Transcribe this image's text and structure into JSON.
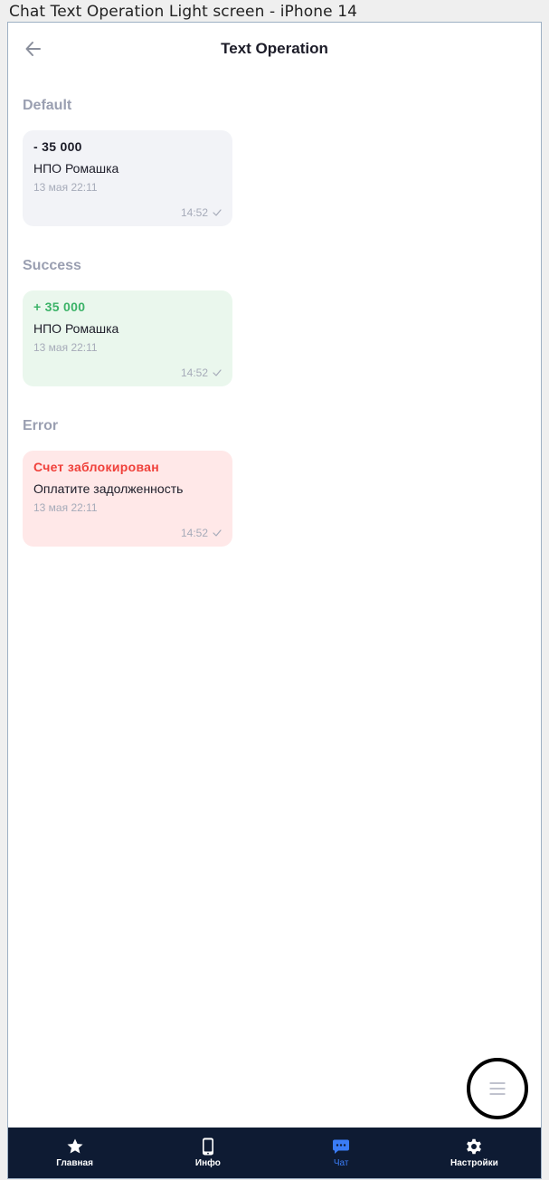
{
  "frame": {
    "title": "Chat Text Operation Light screen - iPhone 14"
  },
  "header": {
    "title": "Text Operation",
    "back_icon": "arrow-left-icon"
  },
  "sections": [
    {
      "label": "Default",
      "bubble": {
        "variant": "default",
        "amount": "- 35 000",
        "company": "НПО Ромашка",
        "date": "13 мая 22:11",
        "time": "14:52"
      }
    },
    {
      "label": "Success",
      "bubble": {
        "variant": "success",
        "amount": "+ 35 000",
        "company": "НПО Ромашка",
        "date": "13 мая 22:11",
        "time": "14:52"
      }
    },
    {
      "label": "Error",
      "bubble": {
        "variant": "error",
        "amount": "Счет заблокирован",
        "company": "Оплатите задолженность",
        "date": "13 мая 22:11",
        "time": "14:52"
      }
    }
  ],
  "fab": {
    "icon": "menu-icon"
  },
  "tabbar": {
    "items": [
      {
        "label": "Главная",
        "icon": "star-icon",
        "active": false
      },
      {
        "label": "Инфо",
        "icon": "phone-icon",
        "active": false
      },
      {
        "label": "Чат",
        "icon": "chat-icon",
        "active": true
      },
      {
        "label": "Настройки",
        "icon": "gear-icon",
        "active": false
      }
    ]
  },
  "colors": {
    "tabbar_bg": "#0e1b33",
    "accent": "#3a7cf6",
    "success": "#3cb368",
    "error": "#f0403a",
    "muted": "#9a9fb1"
  }
}
